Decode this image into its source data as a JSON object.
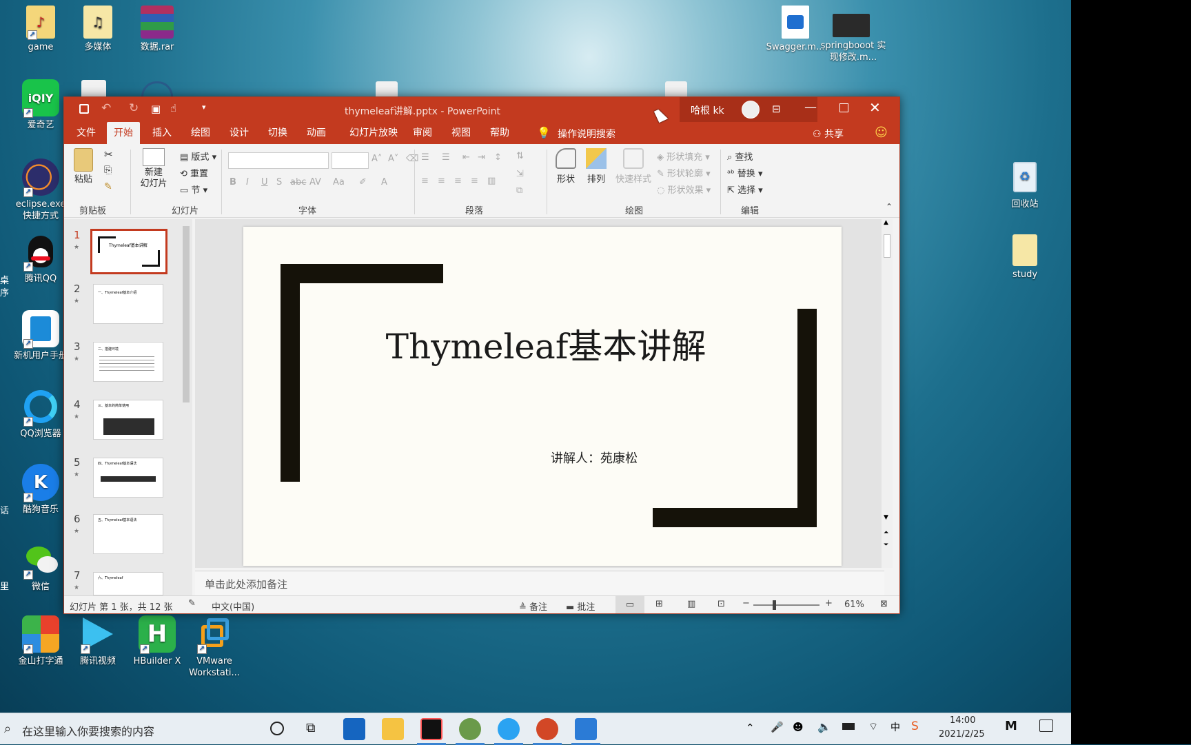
{
  "desktop": {
    "icons_left": [
      {
        "label": "game",
        "icon": "folder-music-icon"
      },
      {
        "label": "多媒体",
        "icon": "folder-icon"
      },
      {
        "label": "数据.rar",
        "icon": "winrar-archive-icon"
      },
      {
        "label": "爱奇艺",
        "icon": "iqiyi-icon",
        "badge": "iQIY"
      },
      {
        "label": "eclipse.exe 快捷方式",
        "icon": "eclipse-icon"
      },
      {
        "label": "腾讯QQ",
        "icon": "qq-penguin-icon"
      },
      {
        "label": "新机用户手册",
        "icon": "book-icon"
      },
      {
        "label": "QQ浏览器",
        "icon": "qq-browser-icon"
      },
      {
        "label": "酷狗音乐",
        "icon": "kugou-icon",
        "badge": "K"
      },
      {
        "label": "微信",
        "icon": "wechat-icon"
      },
      {
        "label": "金山打字通",
        "icon": "kingsoft-typing-icon"
      },
      {
        "label": "腾讯视频",
        "icon": "tencent-video-icon"
      },
      {
        "label": "HBuilder X",
        "icon": "hbuilder-icon",
        "badge": "H"
      },
      {
        "label": "VMware Workstati...",
        "icon": "vmware-icon"
      }
    ],
    "icons_right": [
      {
        "label": "Swagger.m...",
        "icon": "video-file-icon"
      },
      {
        "label": "springbooot 实现修改.m...",
        "icon": "video-file-icon"
      },
      {
        "label": "回收站",
        "icon": "recycle-bin-icon"
      },
      {
        "label": "study",
        "icon": "folder-icon"
      }
    ],
    "edge_fragments": [
      "桌",
      "序",
      "话",
      "里"
    ]
  },
  "window": {
    "title": "thymeleaf讲解.pptx  -  PowerPoint",
    "user": "哈根 kk",
    "share": "共享",
    "tell_me": "操作说明搜索",
    "tabs": [
      "文件",
      "开始",
      "插入",
      "绘图",
      "设计",
      "切换",
      "动画",
      "幻灯片放映",
      "审阅",
      "视图",
      "帮助"
    ],
    "active_tab": "开始"
  },
  "ribbon": {
    "clipboard": {
      "paste": "粘贴",
      "group": "剪贴板"
    },
    "slides": {
      "new_slide": "新建\n幻灯片",
      "layout": "版式",
      "reset": "重置",
      "section": "节",
      "group": "幻灯片"
    },
    "font": {
      "group": "字体",
      "bold": "B",
      "italic": "I",
      "underline": "U",
      "strike": "S",
      "case": "Aa"
    },
    "paragraph": {
      "group": "段落"
    },
    "drawing": {
      "shapes": "形状",
      "arrange": "排列",
      "quick_styles": "快速样式",
      "fill": "形状填充",
      "outline": "形状轮廓",
      "effects": "形状效果",
      "group": "绘图"
    },
    "editing": {
      "find": "查找",
      "replace": "替换",
      "select": "选择",
      "group": "编辑"
    }
  },
  "thumbnails": [
    {
      "num": "1",
      "text": "Thymeleaf基本讲解"
    },
    {
      "num": "2",
      "text": "一、Thymeleaf基本介绍"
    },
    {
      "num": "3",
      "text": "二、搭建环境"
    },
    {
      "num": "4",
      "text": "三、基本的简单使用"
    },
    {
      "num": "5",
      "text": "四、Thymeleaf基本语法"
    },
    {
      "num": "6",
      "text": "五、Thymeleaf基本语法"
    },
    {
      "num": "7",
      "text": "六、Thymeleaf"
    }
  ],
  "slide": {
    "title": "Thymeleaf基本讲解",
    "subtitle": "讲解人：苑康松"
  },
  "notes_placeholder": "单击此处添加备注",
  "status": {
    "slide_info": "幻灯片 第 1 张，共 12 张",
    "language": "中文(中国)",
    "notes": "备注",
    "comments": "批注",
    "zoom": "61%"
  },
  "taskbar": {
    "search_placeholder": "在这里输入你要搜索的内容",
    "time": "14:00",
    "date": "2021/2/25"
  },
  "colors": {
    "accent": "#c33a1f",
    "slide_bg": "#fdfcf6"
  }
}
